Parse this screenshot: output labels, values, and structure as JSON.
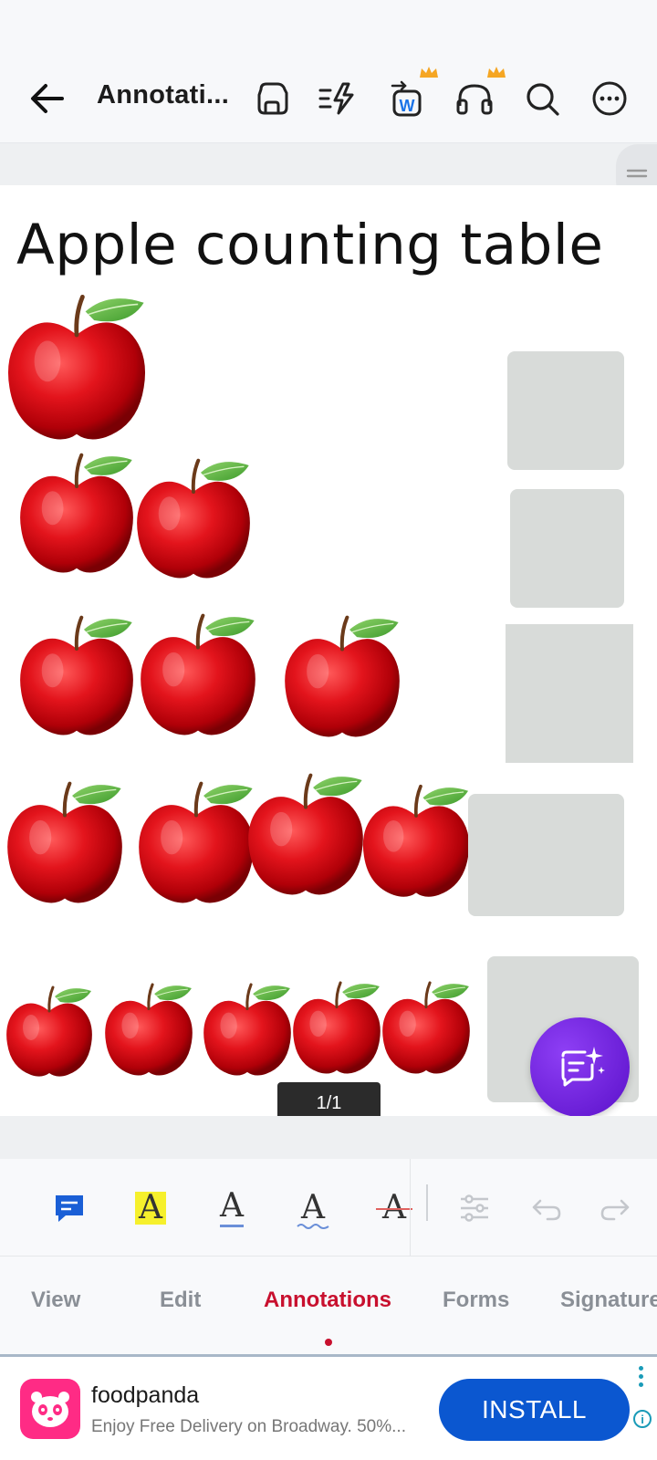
{
  "header": {
    "back_icon": "arrow-left-icon",
    "title": "Annotati...",
    "icons": [
      "save-icon",
      "lightning-list-icon",
      "convert-word-icon",
      "headphones-icon",
      "search-icon",
      "more-icon"
    ],
    "convert_badge_letter": "W",
    "premium_color": "#f5a623"
  },
  "document": {
    "title": "Apple counting table",
    "rows": [
      {
        "apple_count": 1
      },
      {
        "apple_count": 2
      },
      {
        "apple_count": 3
      },
      {
        "apple_count": 4
      },
      {
        "apple_count": 5
      }
    ],
    "answer_box_color": "#d8dbd9",
    "page_indicator": "1/1"
  },
  "annotation_toolbar": {
    "tools": [
      "comment-icon",
      "highlight-icon",
      "underline-icon",
      "squiggly-icon",
      "strikethrough-icon",
      "settings-sliders-icon",
      "undo-icon",
      "redo-icon"
    ],
    "tool_letter": "A",
    "highlight_color": "#f6f02c",
    "comment_color": "#1a5fd6"
  },
  "tabs": {
    "items": [
      "View",
      "Edit",
      "Annotations",
      "Forms",
      "Signature"
    ],
    "active": "Annotations",
    "active_color": "#c8102e"
  },
  "ad": {
    "brand": "foodpanda",
    "subtitle": "Enjoy Free Delivery on Broadway. 50%...",
    "button": "INSTALL",
    "info_letter": "i",
    "brand_color": "#ff2b85",
    "button_color": "#0b57d0"
  }
}
